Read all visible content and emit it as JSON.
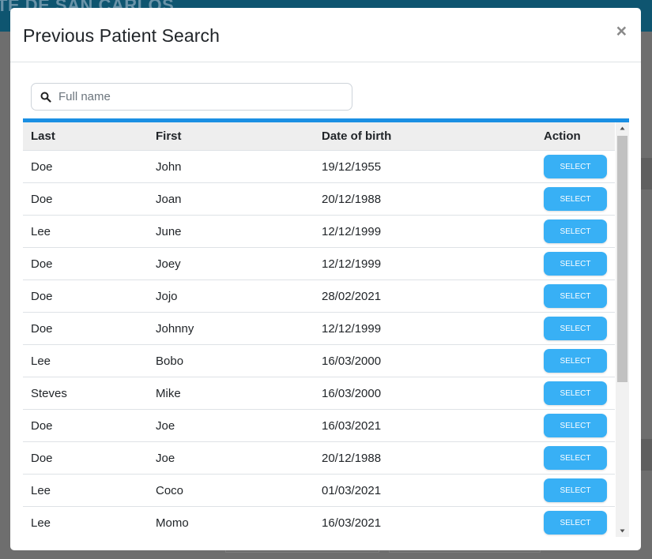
{
  "background": {
    "header_text": "TE DE SAN CARLOS"
  },
  "modal": {
    "title": "Previous Patient Search",
    "close_label": "×",
    "search": {
      "placeholder": "Full name",
      "value": ""
    },
    "table": {
      "columns": [
        "Last",
        "First",
        "Date of birth",
        "Action"
      ],
      "rows": [
        {
          "last": "Doe",
          "first": "John",
          "dob": "19/12/1955",
          "action": "SELECT"
        },
        {
          "last": "Doe",
          "first": "Joan",
          "dob": "20/12/1988",
          "action": "SELECT"
        },
        {
          "last": "Lee",
          "first": "June",
          "dob": "12/12/1999",
          "action": "SELECT"
        },
        {
          "last": "Doe",
          "first": "Joey",
          "dob": "12/12/1999",
          "action": "SELECT"
        },
        {
          "last": "Doe",
          "first": "Jojo",
          "dob": "28/02/2021",
          "action": "SELECT"
        },
        {
          "last": "Doe",
          "first": "Johnny",
          "dob": "12/12/1999",
          "action": "SELECT"
        },
        {
          "last": "Lee",
          "first": "Bobo",
          "dob": "16/03/2000",
          "action": "SELECT"
        },
        {
          "last": "Steves",
          "first": "Mike",
          "dob": "16/03/2000",
          "action": "SELECT"
        },
        {
          "last": "Doe",
          "first": "Joe",
          "dob": "16/03/2021",
          "action": "SELECT"
        },
        {
          "last": "Doe",
          "first": "Joe",
          "dob": "20/12/1988",
          "action": "SELECT"
        },
        {
          "last": "Lee",
          "first": "Coco",
          "dob": "01/03/2021",
          "action": "SELECT"
        },
        {
          "last": "Lee",
          "first": "Momo",
          "dob": "16/03/2021",
          "action": "SELECT"
        }
      ]
    }
  },
  "colors": {
    "accent_bar": "#1a8fe3",
    "select_button": "#38b0f5",
    "header_bg": "#0e5570"
  },
  "icons": {
    "search": "search-icon",
    "close": "close-icon",
    "scroll_up": "scroll-up-arrow-icon",
    "scroll_down": "scroll-down-arrow-icon"
  }
}
